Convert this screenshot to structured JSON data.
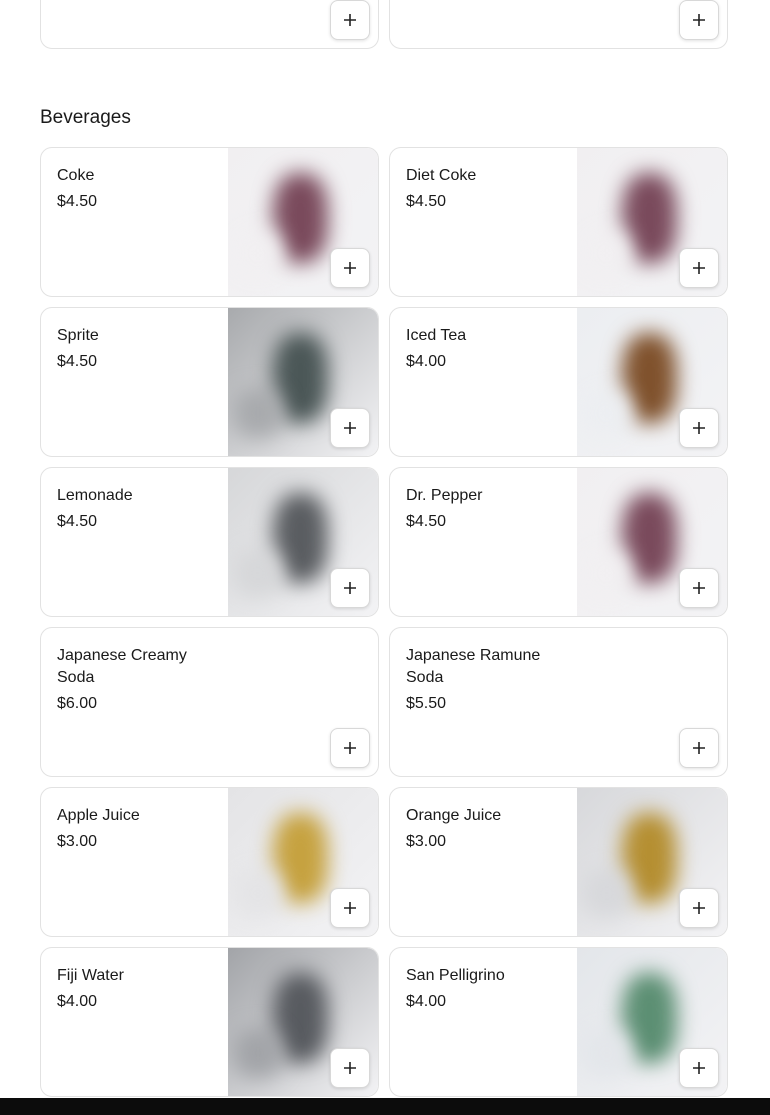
{
  "previous_section": {
    "cards": [
      {
        "add_icon": "plus-icon"
      },
      {
        "add_icon": "plus-icon"
      }
    ]
  },
  "section": {
    "title": "Beverages",
    "items": [
      {
        "name": "Coke",
        "price": "$4.50",
        "has_photo": true,
        "photo_colors": [
          "#f1eff1",
          "#7a4a5c"
        ]
      },
      {
        "name": "Diet Coke",
        "price": "$4.50",
        "has_photo": true,
        "photo_colors": [
          "#f1eff1",
          "#7a4a5c"
        ]
      },
      {
        "name": "Sprite",
        "price": "$4.50",
        "has_photo": true,
        "photo_colors": [
          "#a8aaad",
          "#4b5757"
        ]
      },
      {
        "name": "Iced Tea",
        "price": "$4.00",
        "has_photo": true,
        "photo_colors": [
          "#eceef1",
          "#80522d"
        ]
      },
      {
        "name": "Lemonade",
        "price": "$4.50",
        "has_photo": true,
        "photo_colors": [
          "#d6d7d9",
          "#5a5d61"
        ]
      },
      {
        "name": "Dr. Pepper",
        "price": "$4.50",
        "has_photo": true,
        "photo_colors": [
          "#f1eff1",
          "#7a4a5c"
        ]
      },
      {
        "name": "Japanese Creamy Soda",
        "price": "$6.00",
        "has_photo": false
      },
      {
        "name": "Japanese Ramune Soda",
        "price": "$5.50",
        "has_photo": false
      },
      {
        "name": "Apple Juice",
        "price": "$3.00",
        "has_photo": true,
        "photo_colors": [
          "#e4e4e6",
          "#c6a240"
        ]
      },
      {
        "name": "Orange Juice",
        "price": "$3.00",
        "has_photo": true,
        "photo_colors": [
          "#d7d8db",
          "#b58f32"
        ]
      },
      {
        "name": "Fiji Water",
        "price": "$4.00",
        "has_photo": true,
        "photo_colors": [
          "#a2a4a8",
          "#585b60"
        ]
      },
      {
        "name": "San Pelligrino",
        "price": "$4.00",
        "has_photo": true,
        "photo_colors": [
          "#e3e6ea",
          "#5c8f73"
        ]
      }
    ]
  },
  "icons": {
    "add": "plus-icon"
  }
}
